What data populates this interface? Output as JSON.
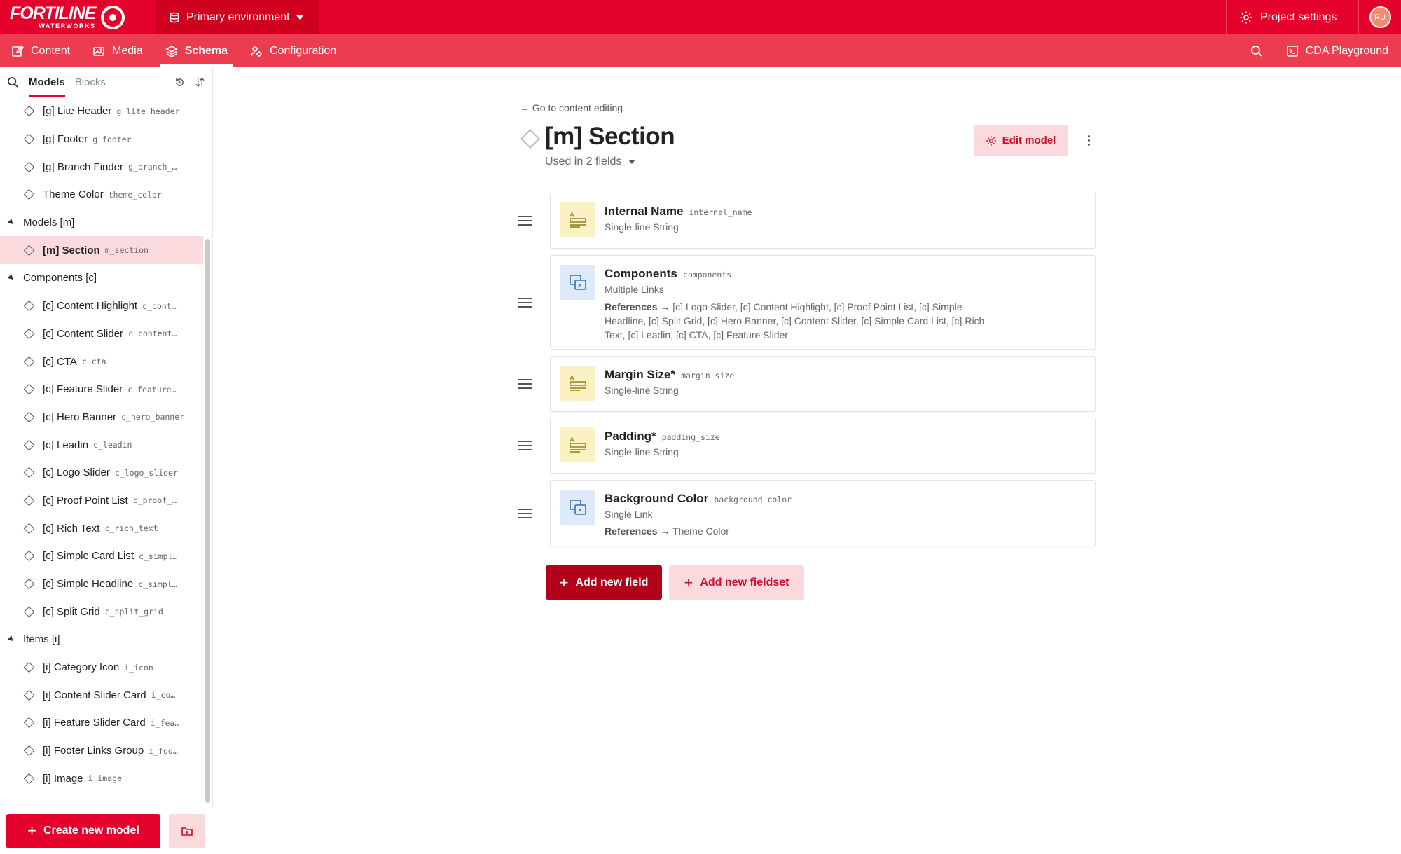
{
  "topbar": {
    "logo_main": "FORTILINE",
    "logo_sub": "WATERWORKS",
    "environment": "Primary environment",
    "project_settings": "Project settings",
    "avatar_initials": "RU"
  },
  "nav": {
    "tabs": [
      {
        "label": "Content",
        "icon": "edit-icon"
      },
      {
        "label": "Media",
        "icon": "image-icon"
      },
      {
        "label": "Schema",
        "icon": "layers-icon",
        "active": true
      },
      {
        "label": "Configuration",
        "icon": "config-icon"
      }
    ],
    "cda_playground": "CDA Playground"
  },
  "sidebar": {
    "tabs": [
      "Models",
      "Blocks"
    ],
    "active_tab": "Models",
    "tree": [
      {
        "kind": "item",
        "label": "[g] Lite Header",
        "api": "g_lite_header"
      },
      {
        "kind": "item",
        "label": "[g] Footer",
        "api": "g_footer"
      },
      {
        "kind": "item",
        "label": "[g] Branch Finder",
        "api": "g_branch_…"
      },
      {
        "kind": "item",
        "label": "Theme Color",
        "api": "theme_color"
      },
      {
        "kind": "group",
        "label": "Models [m]"
      },
      {
        "kind": "item",
        "label": "[m] Section",
        "api": "m_section",
        "selected": true
      },
      {
        "kind": "group",
        "label": "Components [c]"
      },
      {
        "kind": "item",
        "label": "[c] Content Highlight",
        "api": "c_cont…"
      },
      {
        "kind": "item",
        "label": "[c] Content Slider",
        "api": "c_content…"
      },
      {
        "kind": "item",
        "label": "[c] CTA",
        "api": "c_cta"
      },
      {
        "kind": "item",
        "label": "[c] Feature Slider",
        "api": "c_feature…"
      },
      {
        "kind": "item",
        "label": "[c] Hero Banner",
        "api": "c_hero_banner"
      },
      {
        "kind": "item",
        "label": "[c] Leadin",
        "api": "c_leadin"
      },
      {
        "kind": "item",
        "label": "[c] Logo Slider",
        "api": "c_logo_slider"
      },
      {
        "kind": "item",
        "label": "[c] Proof Point List",
        "api": "c_proof_…"
      },
      {
        "kind": "item",
        "label": "[c] Rich Text",
        "api": "c_rich_text"
      },
      {
        "kind": "item",
        "label": "[c] Simple Card List",
        "api": "c_simpl…"
      },
      {
        "kind": "item",
        "label": "[c] Simple Headline",
        "api": "c_simpl…"
      },
      {
        "kind": "item",
        "label": "[c] Split Grid",
        "api": "c_split_grid"
      },
      {
        "kind": "group",
        "label": "Items [i]"
      },
      {
        "kind": "item",
        "label": "[i] Category Icon",
        "api": "i_icon"
      },
      {
        "kind": "item",
        "label": "[i] Content Slider Card",
        "api": "i_co…"
      },
      {
        "kind": "item",
        "label": "[i] Feature Slider Card",
        "api": "i_fea…"
      },
      {
        "kind": "item",
        "label": "[i] Footer Links Group",
        "api": "i_foo…"
      },
      {
        "kind": "item",
        "label": "[i] Image",
        "api": "i_image"
      }
    ],
    "create_button": "Create new model"
  },
  "main": {
    "back_link": "← Go to content editing",
    "title": "[m] Section",
    "used_in": "Used in 2 fields",
    "edit_button": "Edit model",
    "fields": [
      {
        "name": "Internal Name",
        "api": "internal_name",
        "type": "Single-line String",
        "icon": "text-field-icon",
        "references": ""
      },
      {
        "name": "Components",
        "api": "components",
        "type": "Multiple Links",
        "icon": "link-field-icon",
        "references": "[c] Logo Slider, [c] Content Highlight, [c] Proof Point List, [c] Simple Headline, [c] Split Grid, [c] Hero Banner, [c] Content Slider, [c] Simple Card List, [c] Rich Text, [c] Leadin, [c] CTA, [c] Feature Slider"
      },
      {
        "name": "Margin Size*",
        "api": "margin_size",
        "type": "Single-line String",
        "icon": "text-field-icon",
        "references": ""
      },
      {
        "name": "Padding*",
        "api": "padding_size",
        "type": "Single-line String",
        "icon": "text-field-icon",
        "references": ""
      },
      {
        "name": "Background Color",
        "api": "background_color",
        "type": "Single Link",
        "icon": "link-field-icon",
        "references": "Theme Color"
      }
    ],
    "references_label": "References →",
    "add_field": "Add new field",
    "add_fieldset": "Add new fieldset"
  },
  "colors": {
    "brand_red": "#e4012b",
    "nav_red": "#ec3c4f",
    "pale_red": "#fadadd",
    "dark_red": "#b3001b"
  }
}
